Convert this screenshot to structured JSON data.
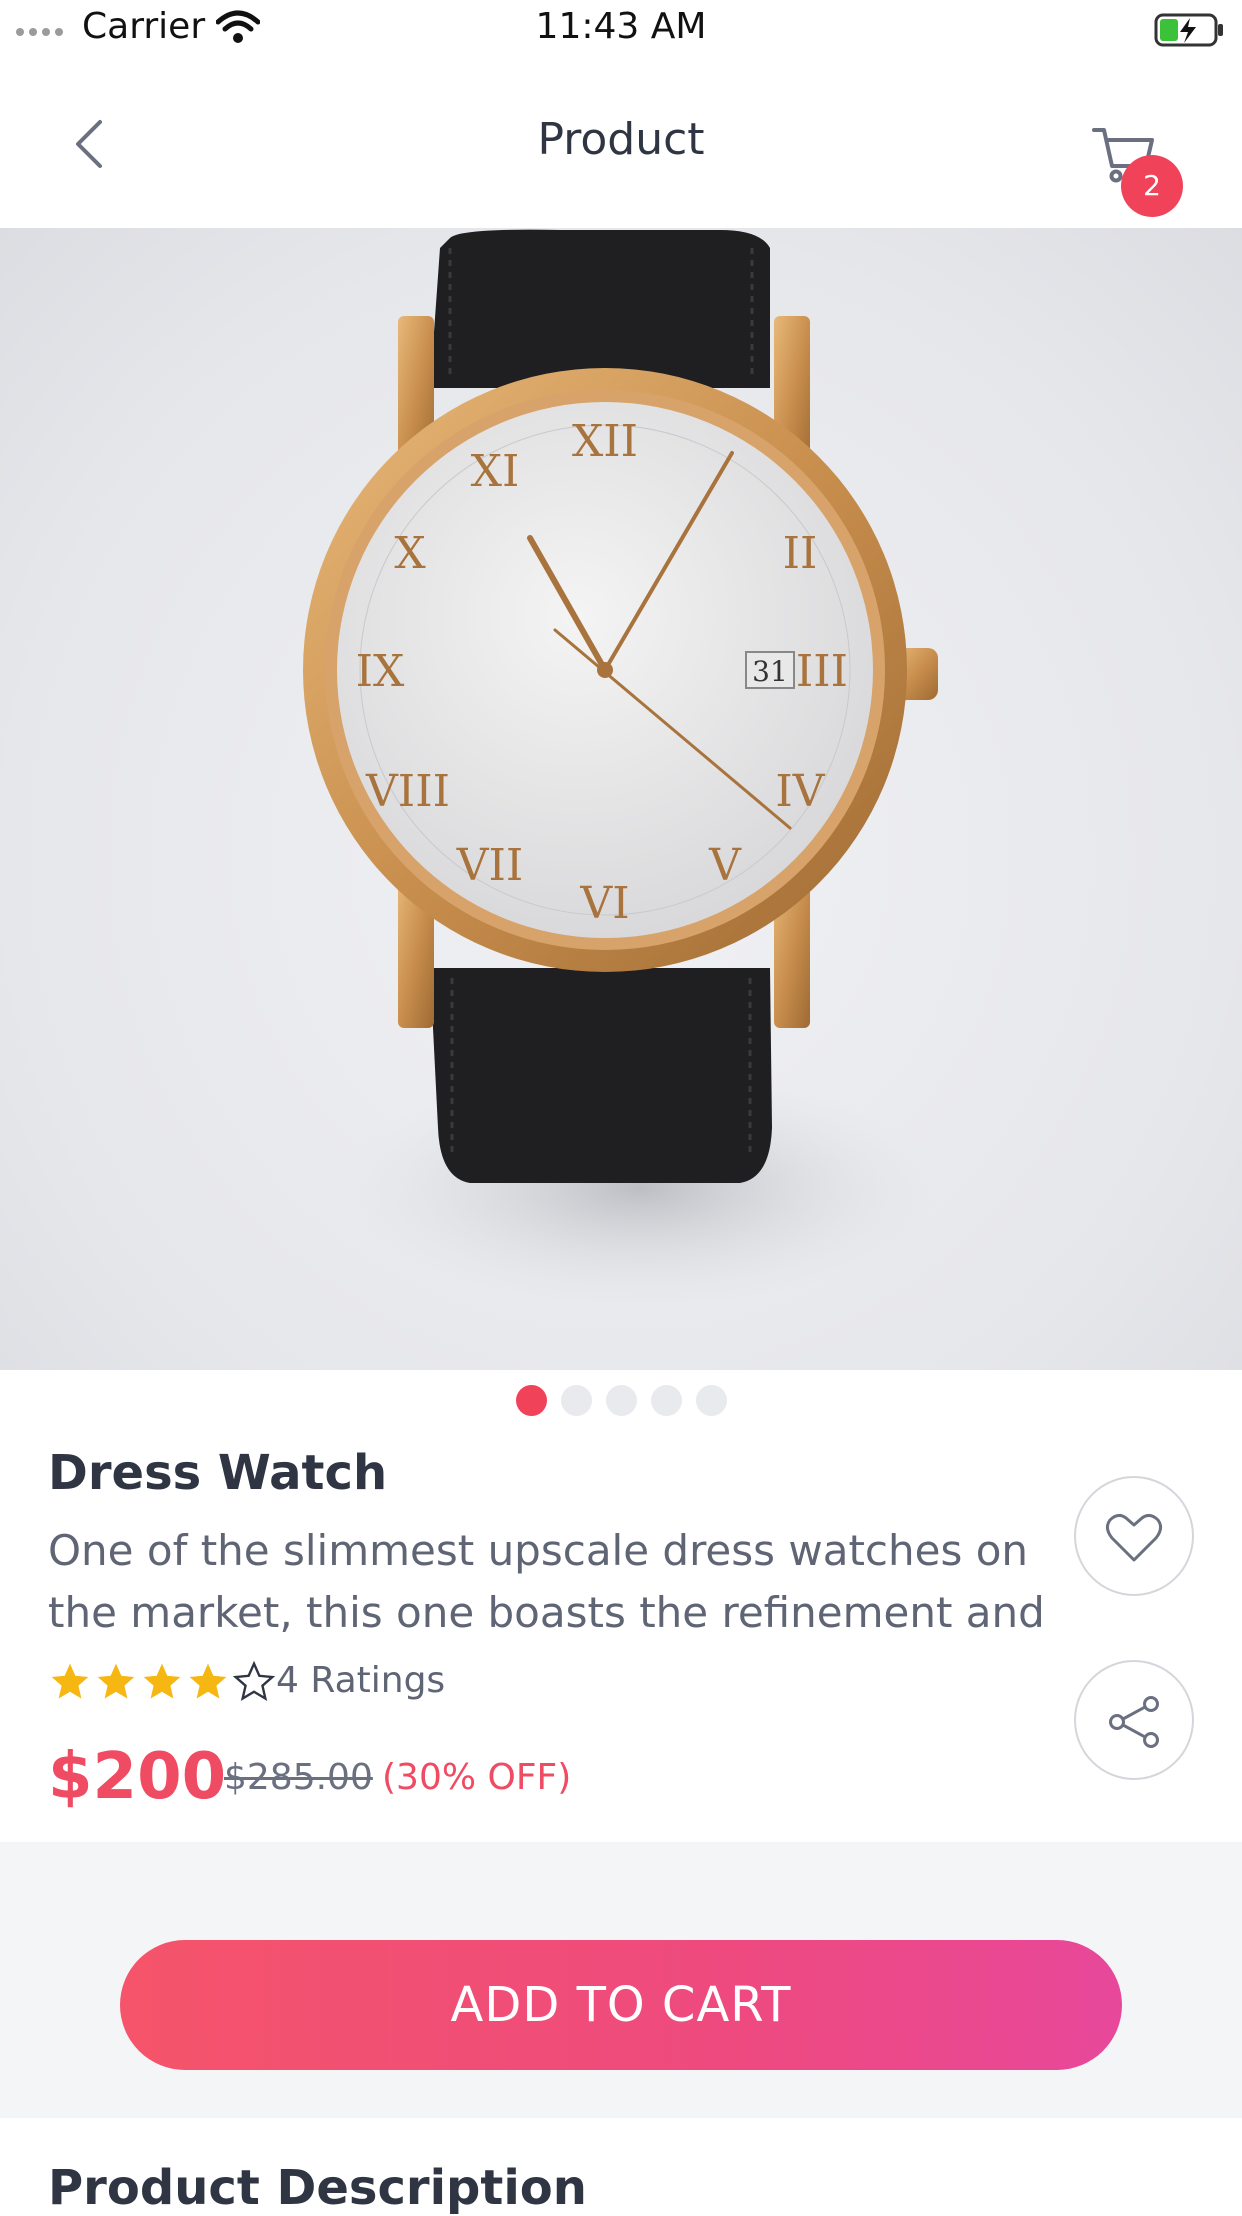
{
  "status_bar": {
    "carrier": "Carrier",
    "time": "11:43 AM"
  },
  "nav": {
    "title": "Product",
    "cart_count": "2"
  },
  "gallery": {
    "page_count": 5,
    "active_index": 0
  },
  "product": {
    "name": "Dress Watch",
    "description_line1": "One of the slimmest upscale dress watches on",
    "description_line2": "the market, this one boasts the refinement and",
    "rating": 4,
    "rating_max": 5,
    "ratings_label": "4 Ratings",
    "price": "$200",
    "old_price": "$285.00",
    "discount": "(30% OFF)"
  },
  "actions": {
    "add_to_cart": "ADD TO CART"
  },
  "sections": {
    "product_description": "Product Description"
  },
  "colors": {
    "accent": "#f0435a",
    "star": "#f6b712",
    "cta_end": "#e8489a"
  }
}
